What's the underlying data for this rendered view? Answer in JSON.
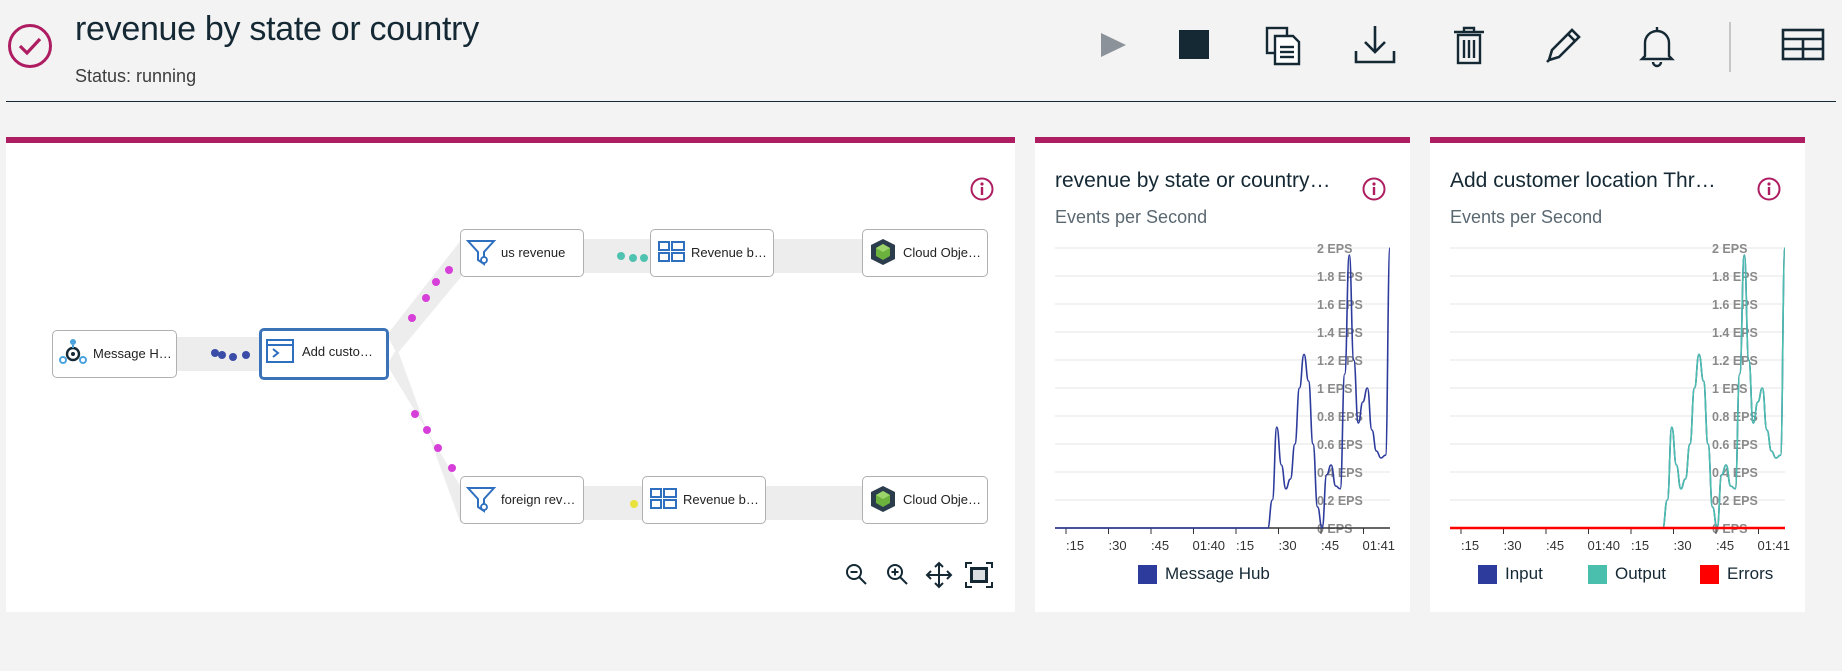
{
  "header": {
    "title": "revenue by state or country",
    "status": "Status: running",
    "accent_color": "#ae1d61",
    "toolbar": [
      {
        "name": "play-button",
        "icon": "play-icon"
      },
      {
        "name": "stop-button",
        "icon": "stop-icon"
      },
      {
        "name": "copy-button",
        "icon": "copy-icon"
      },
      {
        "name": "download-button",
        "icon": "download-icon"
      },
      {
        "name": "delete-button",
        "icon": "trash-icon"
      },
      {
        "name": "edit-button",
        "icon": "pencil-icon"
      },
      {
        "name": "notifications-button",
        "icon": "bell-icon"
      },
      {
        "name": "layout-button",
        "icon": "layout-icon"
      }
    ]
  },
  "flow": {
    "nodes": [
      {
        "id": "message-hub",
        "label": "Message Hub",
        "icon": "message-hub-icon"
      },
      {
        "id": "add-customer",
        "label": "Add custom…",
        "icon": "code-icon",
        "selected": true
      },
      {
        "id": "us-revenue",
        "label": "us revenue",
        "icon": "filter-icon"
      },
      {
        "id": "revenue-by-1",
        "label": "Revenue by …",
        "icon": "aggregate-icon"
      },
      {
        "id": "cloud-object-1",
        "label": "Cloud Objec…",
        "icon": "cloud-object-storage-icon"
      },
      {
        "id": "foreign-revenue",
        "label": "foreign reven…",
        "icon": "filter-icon"
      },
      {
        "id": "revenue-by-2",
        "label": "Revenue by …",
        "icon": "aggregate-icon"
      },
      {
        "id": "cloud-object-2",
        "label": "Cloud Objec…",
        "icon": "cloud-object-storage-icon"
      }
    ],
    "zoom_controls": [
      {
        "name": "zoom-out-button",
        "icon": "zoom-out-icon"
      },
      {
        "name": "zoom-in-button",
        "icon": "zoom-in-icon"
      },
      {
        "name": "pan-button",
        "icon": "move-icon"
      },
      {
        "name": "fit-to-screen-button",
        "icon": "fit-screen-icon"
      }
    ]
  },
  "charts": [
    {
      "title": "revenue by state or country…",
      "subtitle": "Events per Second",
      "legend": [
        {
          "label": "Message Hub",
          "color": "#2d3b9c"
        }
      ]
    },
    {
      "title": "Add customer location Thr…",
      "subtitle": "Events per Second",
      "legend": [
        {
          "label": "Input",
          "color": "#2d3b9c"
        },
        {
          "label": "Output",
          "color": "#4bbfae"
        },
        {
          "label": "Errors",
          "color": "#ff0000"
        }
      ]
    }
  ],
  "chart_data": [
    {
      "type": "line",
      "title": "revenue by state or country…",
      "subtitle": "Events per Second",
      "x_ticks": [
        ":15",
        ":30",
        ":45",
        "01:40",
        ":15",
        ":30",
        ":45",
        "01:41"
      ],
      "y_ticks": [
        "0 EPS",
        "0.2 EPS",
        "0.4 EPS",
        "0.6 EPS",
        "0.8 EPS",
        "1 EPS",
        "1.2 EPS",
        "1.4 EPS",
        "1.6 EPS",
        "1.8 EPS",
        "2 EPS"
      ],
      "ylim": [
        0,
        2
      ],
      "grid": true,
      "legend_position": "bottom",
      "series": [
        {
          "name": "Message Hub",
          "color": "#2d3b9c",
          "values": [
            0,
            0,
            0,
            0,
            0,
            0,
            0,
            0,
            0,
            0,
            0,
            0,
            0,
            0,
            0,
            0,
            0,
            0,
            0,
            0,
            0,
            0,
            0,
            0,
            0,
            0,
            0,
            0,
            0,
            0,
            0,
            0,
            0,
            0,
            0,
            0,
            0,
            0,
            0,
            0,
            0,
            0,
            0,
            0,
            0,
            0,
            0,
            0,
            0.2,
            0.72,
            0.45,
            0.28,
            0.35,
            0.6,
            1.0,
            1.24,
            1.05,
            0.6,
            0.15,
            0,
            0.38,
            0.45,
            0.3,
            0.28,
            1.1,
            1.95,
            1.2,
            0.75,
            0.9,
            1.0,
            0.7,
            0.55,
            0.5,
            0.52,
            2.0
          ]
        }
      ]
    },
    {
      "type": "line",
      "title": "Add customer location Thr…",
      "subtitle": "Events per Second",
      "x_ticks": [
        ":15",
        ":30",
        ":45",
        "01:40",
        ":15",
        ":30",
        ":45",
        "01:41"
      ],
      "y_ticks": [
        "0 EPS",
        "0.2 EPS",
        "0.4 EPS",
        "0.6 EPS",
        "0.8 EPS",
        "1 EPS",
        "1.2 EPS",
        "1.4 EPS",
        "1.6 EPS",
        "1.8 EPS",
        "2 EPS"
      ],
      "ylim": [
        0,
        2
      ],
      "grid": true,
      "legend_position": "bottom",
      "series": [
        {
          "name": "Input",
          "color": "#2d3b9c",
          "values": [
            0,
            0,
            0,
            0,
            0,
            0,
            0,
            0,
            0,
            0,
            0,
            0,
            0,
            0,
            0,
            0,
            0,
            0,
            0,
            0,
            0,
            0,
            0,
            0,
            0,
            0,
            0,
            0,
            0,
            0,
            0,
            0,
            0,
            0,
            0,
            0,
            0,
            0,
            0,
            0,
            0,
            0,
            0,
            0,
            0,
            0,
            0,
            0,
            0.2,
            0.72,
            0.45,
            0.28,
            0.35,
            0.6,
            1.0,
            1.24,
            1.05,
            0.6,
            0.15,
            0,
            0.38,
            0.45,
            0.3,
            0.28,
            1.1,
            1.95,
            1.2,
            0.75,
            0.9,
            1.0,
            0.7,
            0.55,
            0.5,
            0.52,
            2.0
          ]
        },
        {
          "name": "Output",
          "color": "#4bbfae",
          "values": [
            0,
            0,
            0,
            0,
            0,
            0,
            0,
            0,
            0,
            0,
            0,
            0,
            0,
            0,
            0,
            0,
            0,
            0,
            0,
            0,
            0,
            0,
            0,
            0,
            0,
            0,
            0,
            0,
            0,
            0,
            0,
            0,
            0,
            0,
            0,
            0,
            0,
            0,
            0,
            0,
            0,
            0,
            0,
            0,
            0,
            0,
            0,
            0,
            0.2,
            0.72,
            0.45,
            0.28,
            0.35,
            0.6,
            1.0,
            1.24,
            1.05,
            0.6,
            0.15,
            0,
            0.38,
            0.45,
            0.3,
            0.28,
            1.1,
            1.95,
            1.2,
            0.75,
            0.9,
            1.0,
            0.7,
            0.55,
            0.5,
            0.52,
            2.0
          ]
        },
        {
          "name": "Errors",
          "color": "#ff0000",
          "values": [
            0,
            0,
            0,
            0,
            0,
            0,
            0,
            0,
            0,
            0,
            0,
            0,
            0,
            0,
            0,
            0,
            0,
            0,
            0,
            0,
            0,
            0,
            0,
            0,
            0,
            0,
            0,
            0,
            0,
            0,
            0,
            0,
            0,
            0,
            0,
            0,
            0,
            0,
            0,
            0,
            0,
            0,
            0,
            0,
            0,
            0,
            0,
            0,
            0,
            0,
            0,
            0,
            0,
            0,
            0,
            0,
            0,
            0,
            0,
            0,
            0,
            0,
            0,
            0,
            0,
            0,
            0,
            0,
            0,
            0,
            0,
            0,
            0,
            0,
            0
          ]
        }
      ]
    }
  ]
}
